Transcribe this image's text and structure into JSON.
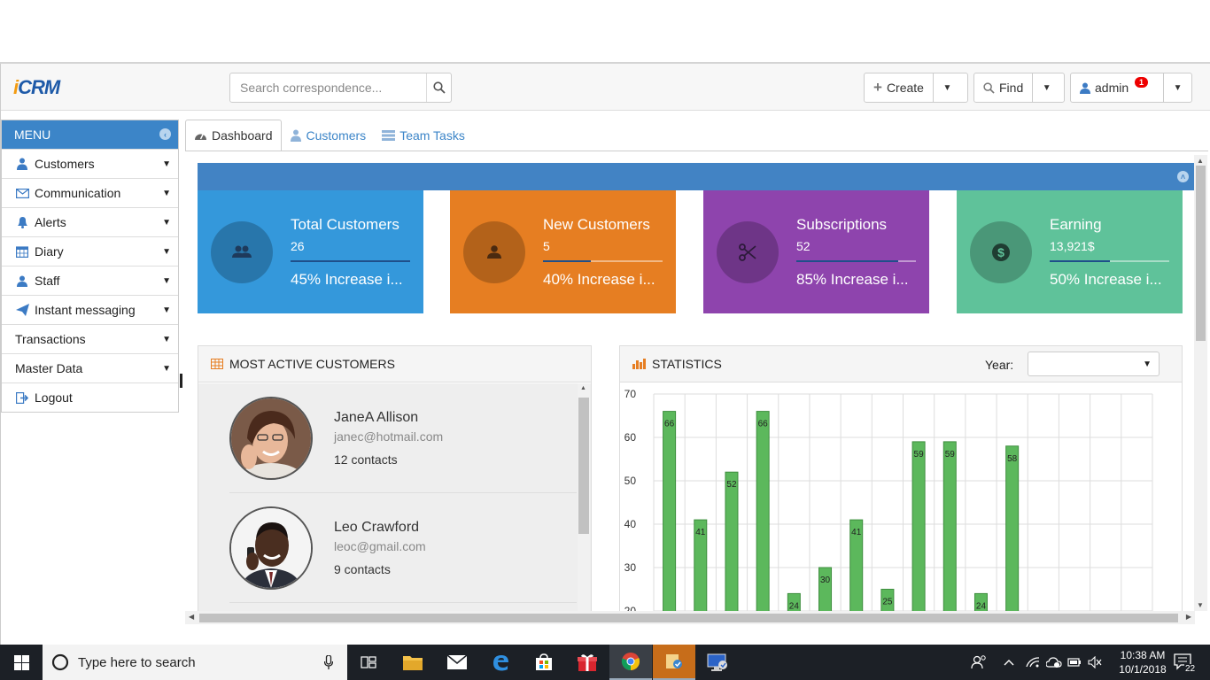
{
  "app": {
    "logo_text": "CRM"
  },
  "search": {
    "placeholder": "Search correspondence..."
  },
  "header": {
    "create_label": "Create",
    "find_label": "Find",
    "user_label": "admin",
    "notification_count": "1"
  },
  "sidebar": {
    "title": "MENU",
    "items": [
      {
        "label": "Customers",
        "icon": "users-icon"
      },
      {
        "label": "Communication",
        "icon": "envelope-icon"
      },
      {
        "label": "Alerts",
        "icon": "bell-icon"
      },
      {
        "label": "Diary",
        "icon": "calendar-icon"
      },
      {
        "label": "Staff",
        "icon": "user-icon"
      },
      {
        "label": "Instant messaging",
        "icon": "paper-plane-icon"
      },
      {
        "label": "Transactions",
        "icon": ""
      },
      {
        "label": "Master Data",
        "icon": ""
      },
      {
        "label": "Logout",
        "icon": "sign-out-icon"
      }
    ]
  },
  "tabs": [
    {
      "label": "Dashboard",
      "icon": "dashboard-icon",
      "active": true
    },
    {
      "label": "Customers",
      "icon": "users-icon",
      "active": false
    },
    {
      "label": "Team Tasks",
      "icon": "list-icon",
      "active": false
    }
  ],
  "stats": [
    {
      "title": "Total Customers",
      "value": "26",
      "desc": "45% Increase i...",
      "progress": 1.0,
      "color": "#3498db",
      "icon": "users-icon"
    },
    {
      "title": "New Customers",
      "value": "5",
      "desc": "40% Increase i...",
      "progress": 0.4,
      "color": "#e67e22",
      "icon": "user-icon"
    },
    {
      "title": "Subscriptions",
      "value": "52",
      "desc": "85% Increase i...",
      "progress": 0.85,
      "color": "#8e44ad",
      "icon": "scissors-icon"
    },
    {
      "title": "Earning",
      "value": "13,921$",
      "desc": "50% Increase i...",
      "progress": 0.5,
      "color": "#5fc29a",
      "icon": "dollar-icon"
    }
  ],
  "customers_panel": {
    "title": "MOST ACTIVE CUSTOMERS",
    "customers": [
      {
        "name": "JaneA Allison",
        "email": "janec@hotmail.com",
        "contacts": "12 contacts"
      },
      {
        "name": "Leo Crawford",
        "email": "leoc@gmail.com",
        "contacts": "9 contacts"
      }
    ]
  },
  "statistics_panel": {
    "title": "STATISTICS",
    "year_label": "Year:",
    "year_value": ""
  },
  "chart_data": {
    "type": "bar",
    "values": [
      66,
      41,
      52,
      66,
      24,
      30,
      41,
      25,
      59,
      59,
      24,
      58
    ],
    "ylim": [
      20,
      70
    ],
    "yticks": [
      20,
      30,
      40,
      50,
      60,
      70
    ],
    "bar_color": "#5cb85c",
    "grid": true
  },
  "taskbar": {
    "search_placeholder": "Type here to search",
    "time": "10:38 AM",
    "date": "10/1/2018",
    "notifications": "22"
  }
}
